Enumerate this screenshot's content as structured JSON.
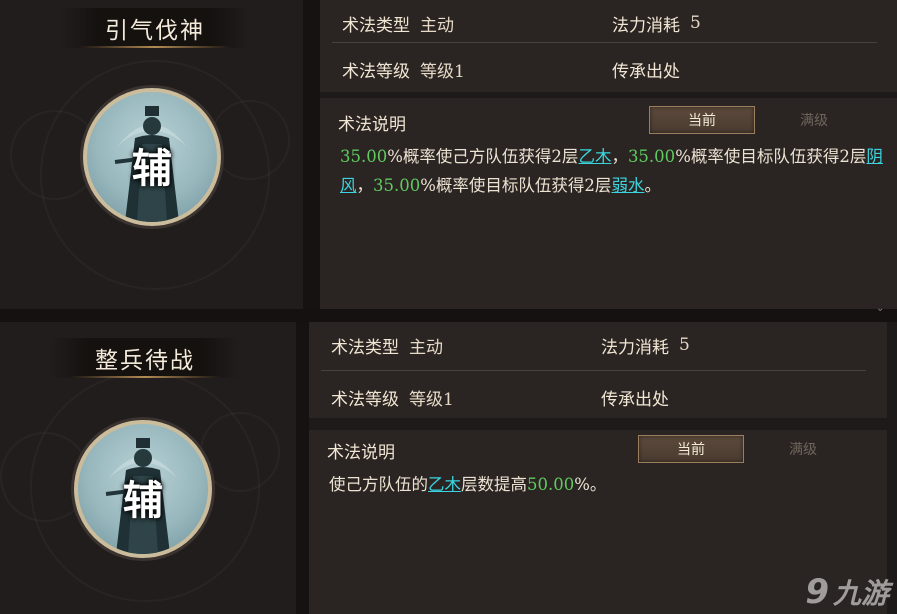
{
  "panels": [
    {
      "skill_name": "引气伐神",
      "role_char": "辅",
      "type_label": "术法类型",
      "type_value": "主动",
      "cost_label": "法力消耗",
      "cost_value": "5",
      "level_label": "术法等级",
      "level_value": "等级1",
      "origin_label": "传承出处",
      "origin_value": "",
      "desc_title": "术法说明",
      "tab_current": "当前",
      "tab_max": "满级",
      "desc_segments": [
        {
          "t": "35.00",
          "k": "num"
        },
        {
          "t": "%概率使己方队伍获得2层",
          "k": "txt"
        },
        {
          "t": "乙木",
          "k": "kw"
        },
        {
          "t": "，",
          "k": "txt"
        },
        {
          "t": "35.00",
          "k": "num"
        },
        {
          "t": "%概率使目标队伍获得2层",
          "k": "txt"
        },
        {
          "t": "阴风",
          "k": "kw"
        },
        {
          "t": "，",
          "k": "txt"
        },
        {
          "t": "35.00",
          "k": "num"
        },
        {
          "t": "%概率使目标队伍获得2层",
          "k": "txt"
        },
        {
          "t": "弱水",
          "k": "kw"
        },
        {
          "t": "。",
          "k": "txt"
        }
      ]
    },
    {
      "skill_name": "整兵待战",
      "role_char": "辅",
      "type_label": "术法类型",
      "type_value": "主动",
      "cost_label": "法力消耗",
      "cost_value": "5",
      "level_label": "术法等级",
      "level_value": "等级1",
      "origin_label": "传承出处",
      "origin_value": "",
      "desc_title": "术法说明",
      "tab_current": "当前",
      "tab_max": "满级",
      "desc_segments": [
        {
          "t": "使己方队伍的",
          "k": "txt"
        },
        {
          "t": "乙木",
          "k": "kw"
        },
        {
          "t": "层数提高",
          "k": "txt"
        },
        {
          "t": "50.00",
          "k": "num"
        },
        {
          "t": "%。",
          "k": "txt"
        }
      ]
    }
  ],
  "watermark": {
    "logo": "9",
    "text": "九游"
  },
  "scroll_chevron": "⌄"
}
